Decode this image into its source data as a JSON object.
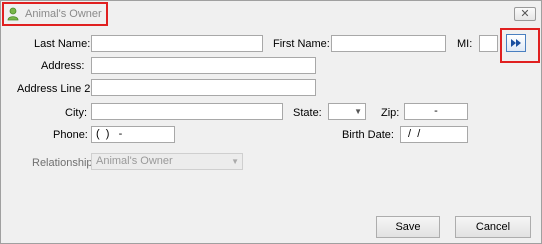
{
  "window": {
    "title": "Animal's Owner",
    "close_glyph": "✕"
  },
  "form": {
    "last_name_label": "Last Name:",
    "last_name_value": "",
    "first_name_label": "First Name:",
    "first_name_value": "",
    "mi_label": "MI:",
    "mi_value": "",
    "address_label": "Address:",
    "address_value": "",
    "address2_label": "Address Line 2:",
    "address2_value": "",
    "city_label": "City:",
    "city_value": "",
    "state_label": "State:",
    "state_value": "",
    "zip_label": "Zip:",
    "zip_value": "-",
    "phone_label": "Phone:",
    "phone_value": "(  )   -",
    "birth_date_label": "Birth Date:",
    "birth_date_value": " /  /",
    "relationship_label": "Relationship:",
    "relationship_value": "Animal's Owner"
  },
  "buttons": {
    "save": "Save",
    "cancel": "Cancel"
  },
  "icons": {
    "title": "person-icon",
    "next": "fast-forward-icon",
    "close": "close-icon"
  },
  "colors": {
    "highlight": "#e02020",
    "accent": "#1a4fa0",
    "disabled_text": "#707070"
  }
}
